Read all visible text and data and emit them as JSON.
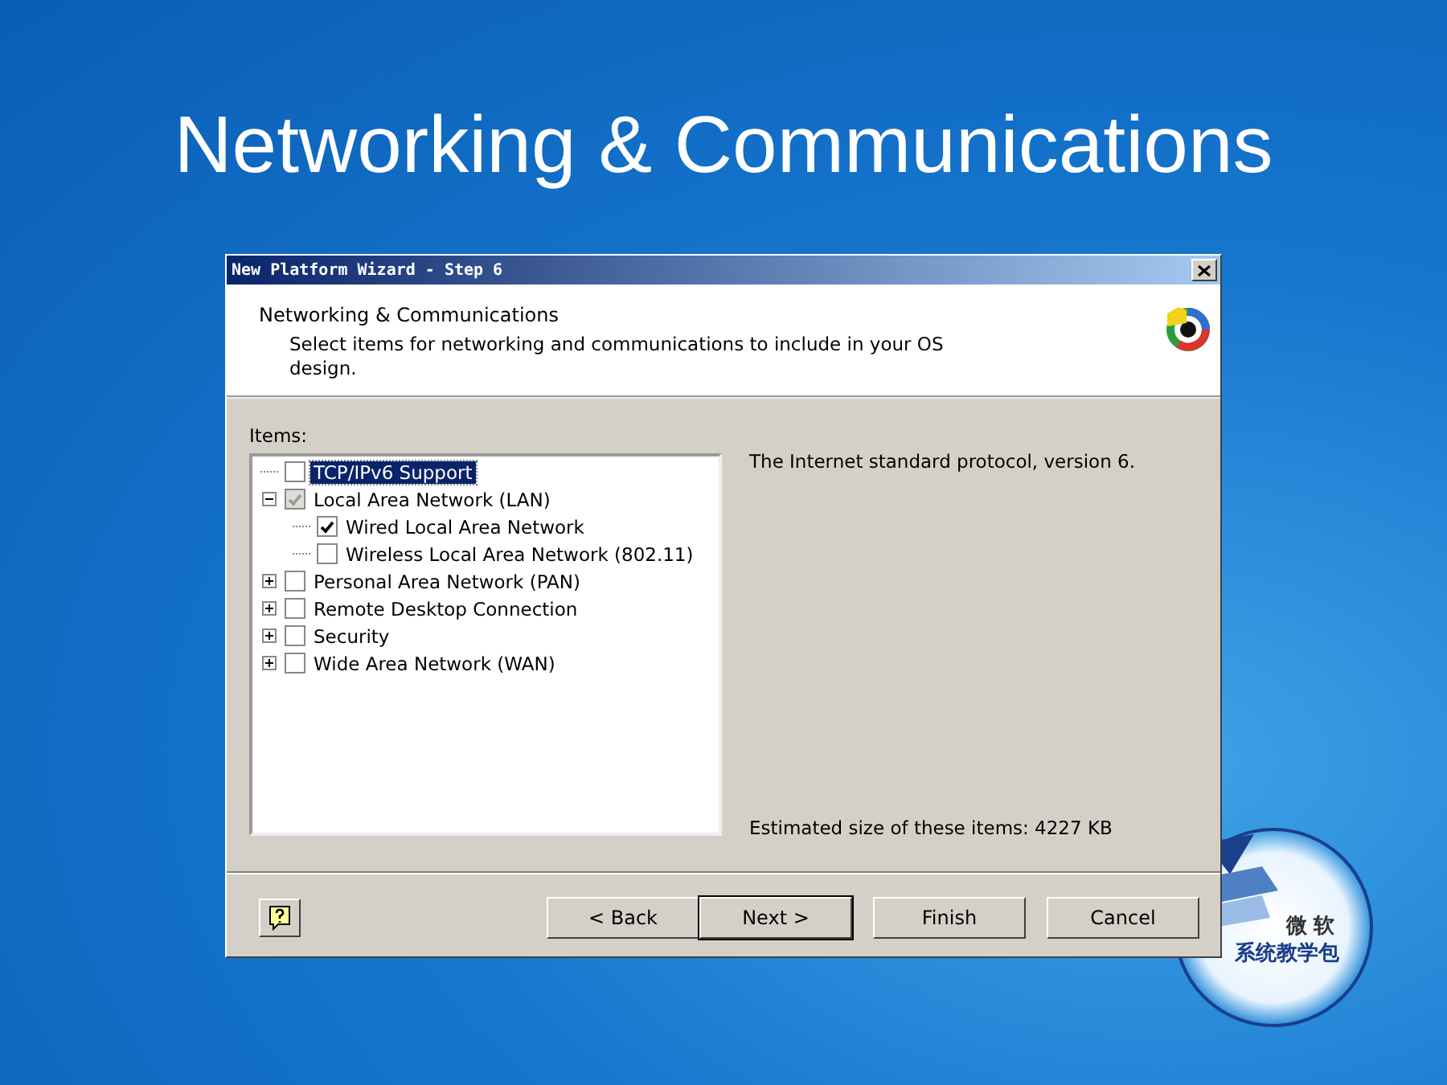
{
  "slide": {
    "title": "Networking & Communications"
  },
  "logo": {
    "line_1": "微软",
    "line_2": "系统教学包"
  },
  "window": {
    "title": "New Platform Wizard - Step 6"
  },
  "header": {
    "heading": "Networking & Communications",
    "description": "Select items for networking and communications to include in your OS design."
  },
  "items_label": "Items:",
  "tree": [
    {
      "label": "TCP/IPv6 Support",
      "checked": false,
      "selected": true
    },
    {
      "label": "Local Area Network (LAN)",
      "checked": true,
      "dimmed": true,
      "selected": false,
      "expanded": true,
      "children": [
        {
          "label": "Wired Local Area Network",
          "checked": true,
          "selected": false
        },
        {
          "label": "Wireless Local Area Network (802.11)",
          "checked": false,
          "selected": false
        }
      ]
    },
    {
      "label": "Personal Area Network (PAN)",
      "checked": false,
      "selected": false,
      "expanded": false
    },
    {
      "label": "Remote Desktop Connection",
      "checked": false,
      "selected": false,
      "expanded": false
    },
    {
      "label": "Security",
      "checked": false,
      "selected": false,
      "expanded": false
    },
    {
      "label": "Wide Area Network (WAN)",
      "checked": false,
      "selected": false,
      "expanded": false
    }
  ],
  "item_description": "The Internet standard protocol, version 6.",
  "estimated_size": "Estimated size of these items: 4227 KB",
  "buttons": [
    {
      "label": "< Back",
      "default": false
    },
    {
      "label": "Next >",
      "default": true
    },
    {
      "label": "Finish",
      "default": false
    },
    {
      "label": "Cancel",
      "default": false
    }
  ]
}
